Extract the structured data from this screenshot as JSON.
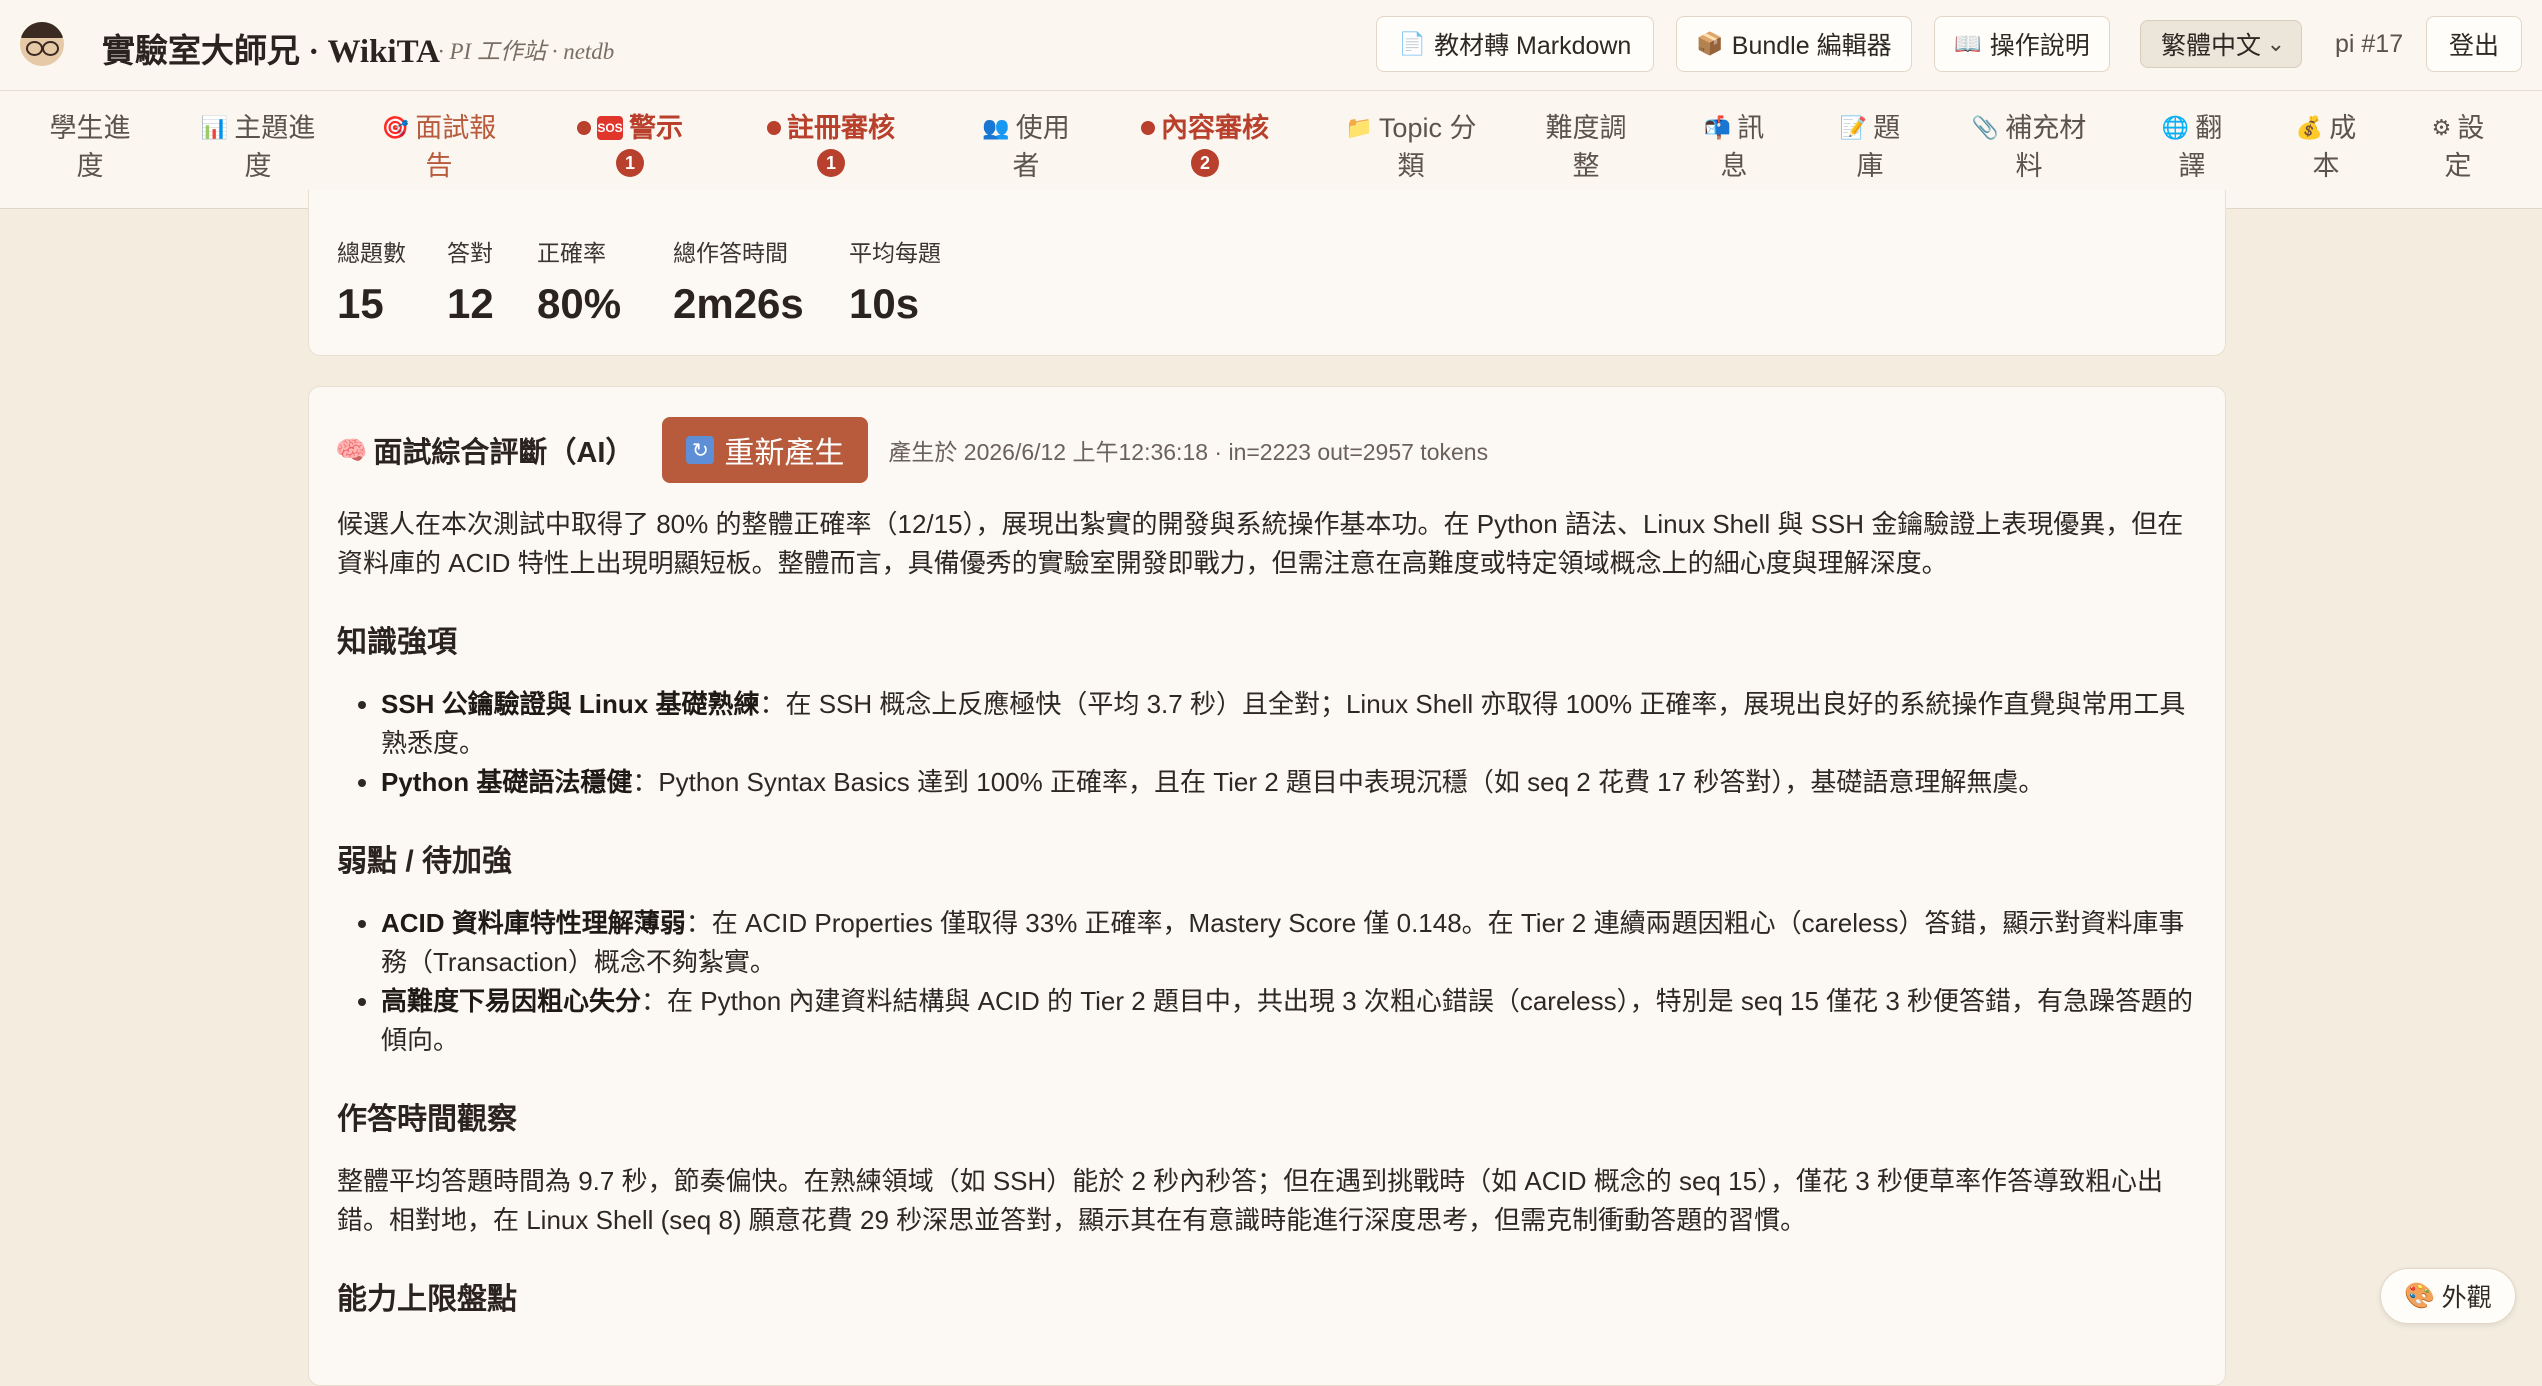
{
  "header": {
    "title": "實驗室大師兄 · WikiTA",
    "subtitle": "· PI 工作站 · netdb",
    "buttons": [
      {
        "icon": "page-icon",
        "glyph": "📄",
        "label": "教材轉 Markdown"
      },
      {
        "icon": "package-icon",
        "glyph": "📦",
        "label": "Bundle 編輯器"
      },
      {
        "icon": "book-icon",
        "glyph": "📖",
        "label": "操作說明"
      }
    ],
    "language": "繁體中文",
    "user": "pi #17",
    "logout": "登出"
  },
  "nav": {
    "tabs": [
      {
        "line1": "學生進",
        "line2": "度",
        "icon": ""
      },
      {
        "line1": "主題進",
        "line2": "度",
        "icon": "📊"
      },
      {
        "line1": "面試報",
        "line2": "告",
        "icon": "🎯"
      },
      {
        "line1": "警示",
        "line2": "",
        "icon": "🆘",
        "badge": "1"
      },
      {
        "line1": "註冊審核",
        "line2": "",
        "icon": "",
        "badge": "1"
      },
      {
        "line1": "使用",
        "line2": "者",
        "icon": "👥"
      },
      {
        "line1": "內容審核",
        "line2": "",
        "icon": "",
        "badge": "2"
      },
      {
        "line1": "Topic 分",
        "line2": "類",
        "icon": "📁"
      },
      {
        "line1": "難度調",
        "line2": "整",
        "icon": ""
      },
      {
        "line1": "訊",
        "line2": "息",
        "icon": "📬"
      },
      {
        "line1": "題",
        "line2": "庫",
        "icon": "📝"
      },
      {
        "line1": "補充材",
        "line2": "料",
        "icon": "📎"
      },
      {
        "line1": "翻",
        "line2": "譯",
        "icon": "🌐"
      },
      {
        "line1": "成",
        "line2": "本",
        "icon": "💰"
      },
      {
        "line1": "設",
        "line2": "定",
        "icon": "⚙"
      }
    ],
    "active_tab": "面試報告",
    "colors": {
      "active": "#b85a3c",
      "alert": "#b8402c"
    }
  },
  "stats": [
    {
      "label": "總題數",
      "value": "15"
    },
    {
      "label": "答對",
      "value": "12"
    },
    {
      "label": "正確率",
      "value": "80%"
    },
    {
      "label": "總作答時間",
      "value": "2m26s"
    },
    {
      "label": "平均每題",
      "value": "10s"
    }
  ],
  "assessment": {
    "icon": "🧠",
    "title": "面試綜合評斷（AI）",
    "regen_icon": "🔄",
    "regen_label": "重新產生",
    "meta": "產生於 2026/6/12 上午12:36:18 · in=2223 out=2957 tokens",
    "summary": "候選人在本次測試中取得了 80% 的整體正確率（12/15），展現出紮實的開發與系統操作基本功。在 Python 語法、Linux Shell 與 SSH 金鑰驗證上表現優異，但在資料庫的 ACID 特性上出現明顯短板。整體而言，具備優秀的實驗室開發即戰力，但需注意在高難度或特定領域概念上的細心度與理解深度。",
    "strengths_heading": "知識強項",
    "strengths": [
      {
        "bold": "SSH 公鑰驗證與 Linux 基礎熟練",
        "text": "：在 SSH 概念上反應極快（平均 3.7 秒）且全對；Linux Shell 亦取得 100% 正確率，展現出良好的系統操作直覺與常用工具熟悉度。"
      },
      {
        "bold": "Python 基礎語法穩健",
        "text": "：Python Syntax Basics 達到 100% 正確率，且在 Tier 2 題目中表現沉穩（如 seq 2 花費 17 秒答對），基礎語意理解無虞。"
      }
    ],
    "weak_heading": "弱點 / 待加強",
    "weaknesses": [
      {
        "bold": "ACID 資料庫特性理解薄弱",
        "text": "：在 ACID Properties 僅取得 33% 正確率，Mastery Score 僅 0.148。在 Tier 2 連續兩題因粗心（careless）答錯，顯示對資料庫事務（Transaction）概念不夠紮實。"
      },
      {
        "bold": "高難度下易因粗心失分",
        "text": "：在 Python 內建資料結構與 ACID 的 Tier 2 題目中，共出現 3 次粗心錯誤（careless），特別是 seq 15 僅花 3 秒便答錯，有急躁答題的傾向。"
      }
    ],
    "time_heading": "作答時間觀察",
    "time_text": "整體平均答題時間為 9.7 秒，節奏偏快。在熟練領域（如 SSH）能於 2 秒內秒答；但在遇到挑戰時（如 ACID 概念的 seq 15），僅花 3 秒便草率作答導致粗心出錯。相對地，在 Linux Shell (seq 8) 願意花費 29 秒深思並答對，顯示其在有意識時能進行深度思考，但需克制衝動答題的習慣。",
    "ceiling_heading": "能力上限盤點"
  },
  "appearance": {
    "icon": "🎨",
    "label": "外觀"
  }
}
